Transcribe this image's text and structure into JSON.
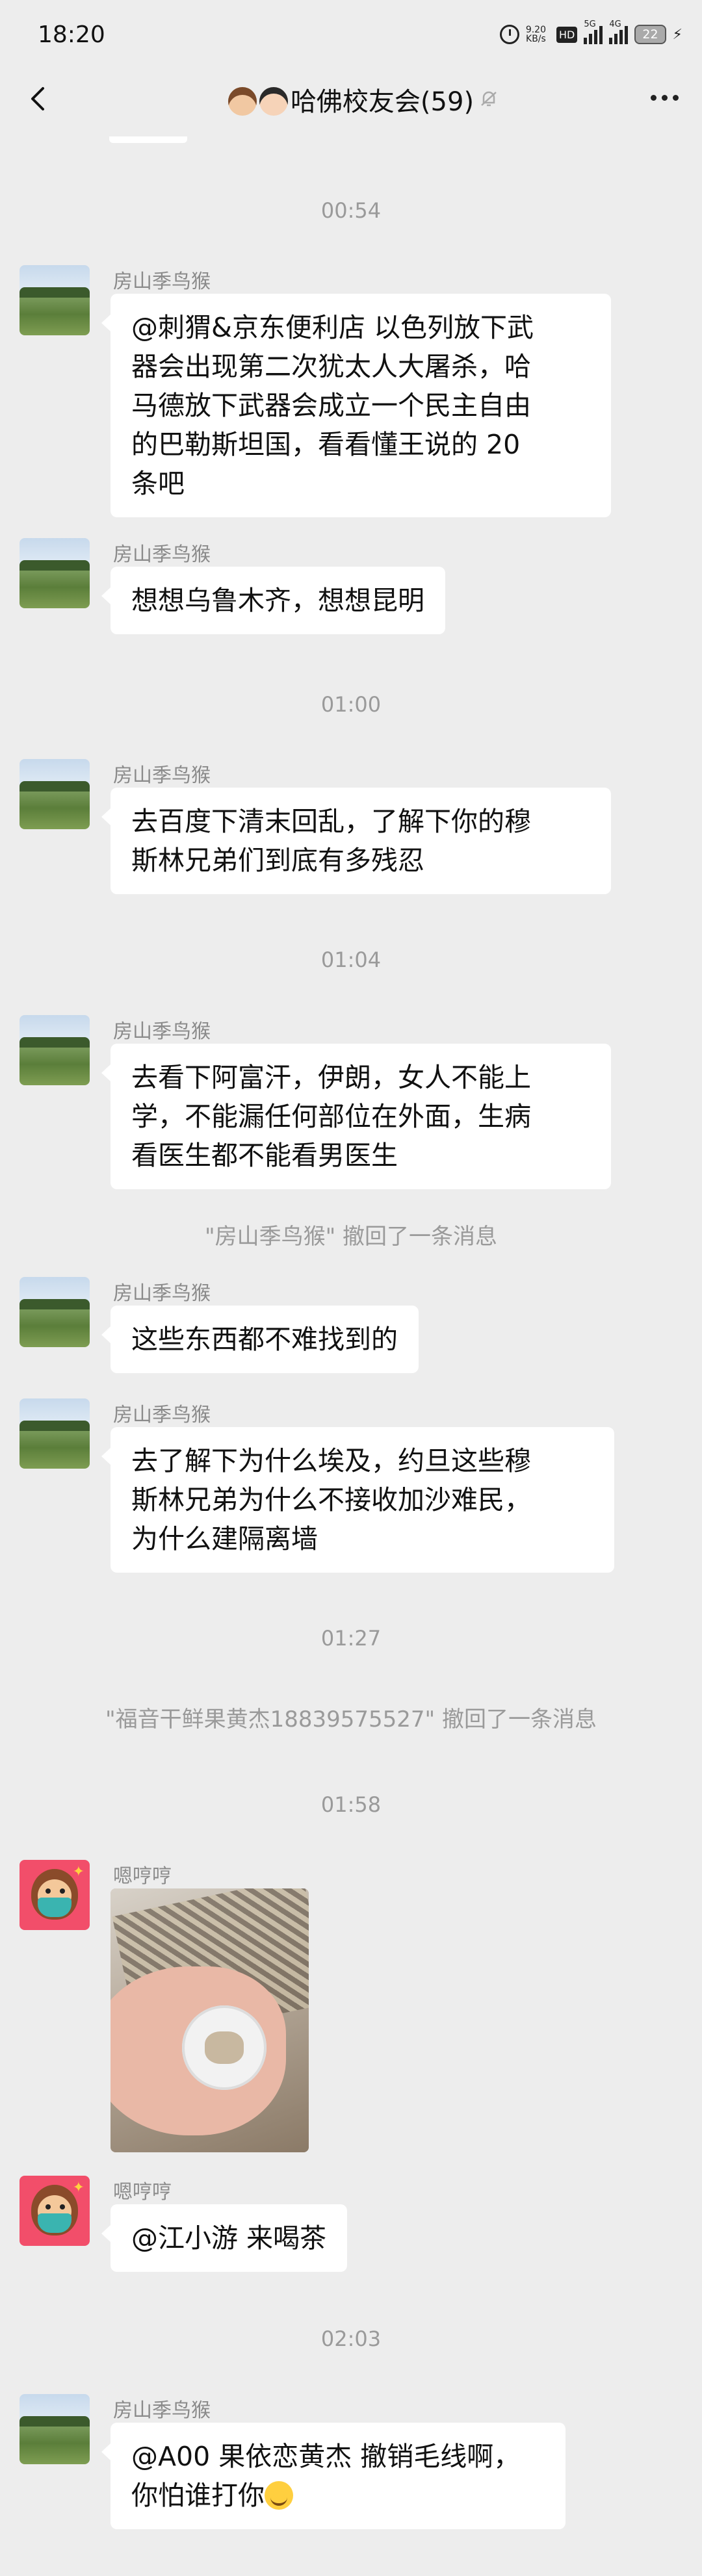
{
  "status_bar": {
    "time": "18:20",
    "net_speed_value": "9.20",
    "net_speed_unit": "KB/s",
    "hd_label": "HD",
    "signal1_label": "5G",
    "signal2_label": "4G",
    "battery": "22",
    "bolt_icon": "⚡"
  },
  "header": {
    "title": "哈佛校友会(59)",
    "icons": [
      "back-arrow-icon",
      "man-emoji-icon",
      "woman-emoji-icon",
      "mute-bell-icon",
      "more-icon"
    ]
  },
  "messages": {
    "t1": "00:54",
    "m1": {
      "sender": "房山季鸟猴",
      "lines": [
        "@刺猬&京东便利店  以色列放下武",
        "器会出现第二次犹太人大屠杀，哈",
        "马德放下武器会成立一个民主自由",
        "的巴勒斯坦国，看看懂王说的 20",
        "条吧"
      ]
    },
    "m2": {
      "sender": "房山季鸟猴",
      "lines": [
        "想想乌鲁木齐，想想昆明"
      ]
    },
    "t2": "01:00",
    "m3": {
      "sender": "房山季鸟猴",
      "lines": [
        "去百度下清末回乱，了解下你的穆",
        "斯林兄弟们到底有多残忍"
      ]
    },
    "t3": "01:04",
    "m4": {
      "sender": "房山季鸟猴",
      "lines": [
        "去看下阿富汗，伊朗，女人不能上",
        "学，不能漏任何部位在外面，生病",
        "看医生都不能看男医生"
      ]
    },
    "sys1": "\"房山季鸟猴\" 撤回了一条消息",
    "m5": {
      "sender": "房山季鸟猴",
      "lines": [
        "这些东西都不难找到的"
      ]
    },
    "m6": {
      "sender": "房山季鸟猴",
      "lines": [
        "去了解下为什么埃及，约旦这些穆",
        "斯林兄弟为什么不接收加沙难民，",
        "为什么建隔离墙"
      ]
    },
    "t4": "01:27",
    "sys2": "\"福音干鲜果黄杰18839575527\" 撤回了一条消息",
    "t5": "01:58",
    "m7": {
      "sender": "嗯哼哼",
      "type": "image"
    },
    "m8": {
      "sender": "嗯哼哼",
      "lines": [
        "@江小游  来喝茶"
      ]
    },
    "t6": "02:03",
    "m9": {
      "sender": "房山季鸟猴",
      "lines": [
        "@A00 果依恋黄杰  撤销毛线啊，",
        "你怕谁打你"
      ],
      "trailing_emoji": "grin-sweat-emoji-icon"
    }
  }
}
